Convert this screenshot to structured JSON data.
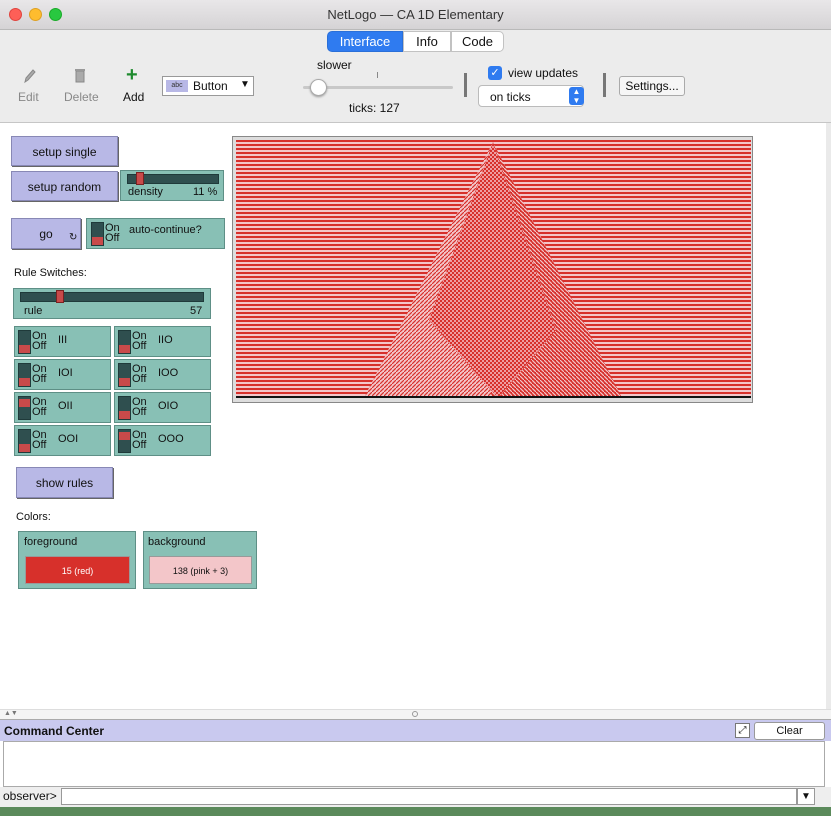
{
  "window": {
    "title": "NetLogo — CA 1D Elementary"
  },
  "tabs": [
    {
      "label": "Interface"
    },
    {
      "label": "Info"
    },
    {
      "label": "Code"
    }
  ],
  "toolbar": {
    "edit_label": "Edit",
    "delete_label": "Delete",
    "add_label": "Add",
    "widget_type": "Button",
    "speed_label": "slower",
    "ticks_text": "ticks: 127",
    "view_updates_label": "view updates",
    "view_updates_checked": true,
    "update_mode": "on ticks",
    "settings_label": "Settings..."
  },
  "widgets": {
    "setup_single": "setup single",
    "setup_random": "setup random",
    "density": {
      "label": "density",
      "value": "11 %",
      "fraction": 0.11
    },
    "go": "go",
    "auto_continue": {
      "label": "auto-continue?",
      "on": "On",
      "off": "Off",
      "state": "off"
    },
    "rule_switches_label": "Rule Switches:",
    "rule": {
      "label": "rule",
      "value": "57",
      "fraction": 0.22
    },
    "switches": [
      {
        "label": "III",
        "state": "off"
      },
      {
        "label": "IIO",
        "state": "off"
      },
      {
        "label": "IOI",
        "state": "off"
      },
      {
        "label": "IOO",
        "state": "off"
      },
      {
        "label": "OII",
        "state": "on"
      },
      {
        "label": "OIO",
        "state": "off"
      },
      {
        "label": "OOI",
        "state": "off"
      },
      {
        "label": "OOO",
        "state": "on"
      }
    ],
    "switch_on": "On",
    "switch_off": "Off",
    "show_rules": "show rules",
    "colors_label": "Colors:",
    "foreground": {
      "label": "foreground",
      "value": "15 (red)",
      "color": "#d7302b"
    },
    "background": {
      "label": "background",
      "value": "138 (pink + 3)",
      "color": "#f3c6c9"
    }
  },
  "command_center": {
    "title": "Command Center",
    "clear_label": "Clear",
    "prompt": "observer>",
    "input_value": ""
  },
  "colors": {
    "accent": "#2a73e8",
    "widget": "#88c0b5",
    "button": "#b8b8e6"
  }
}
